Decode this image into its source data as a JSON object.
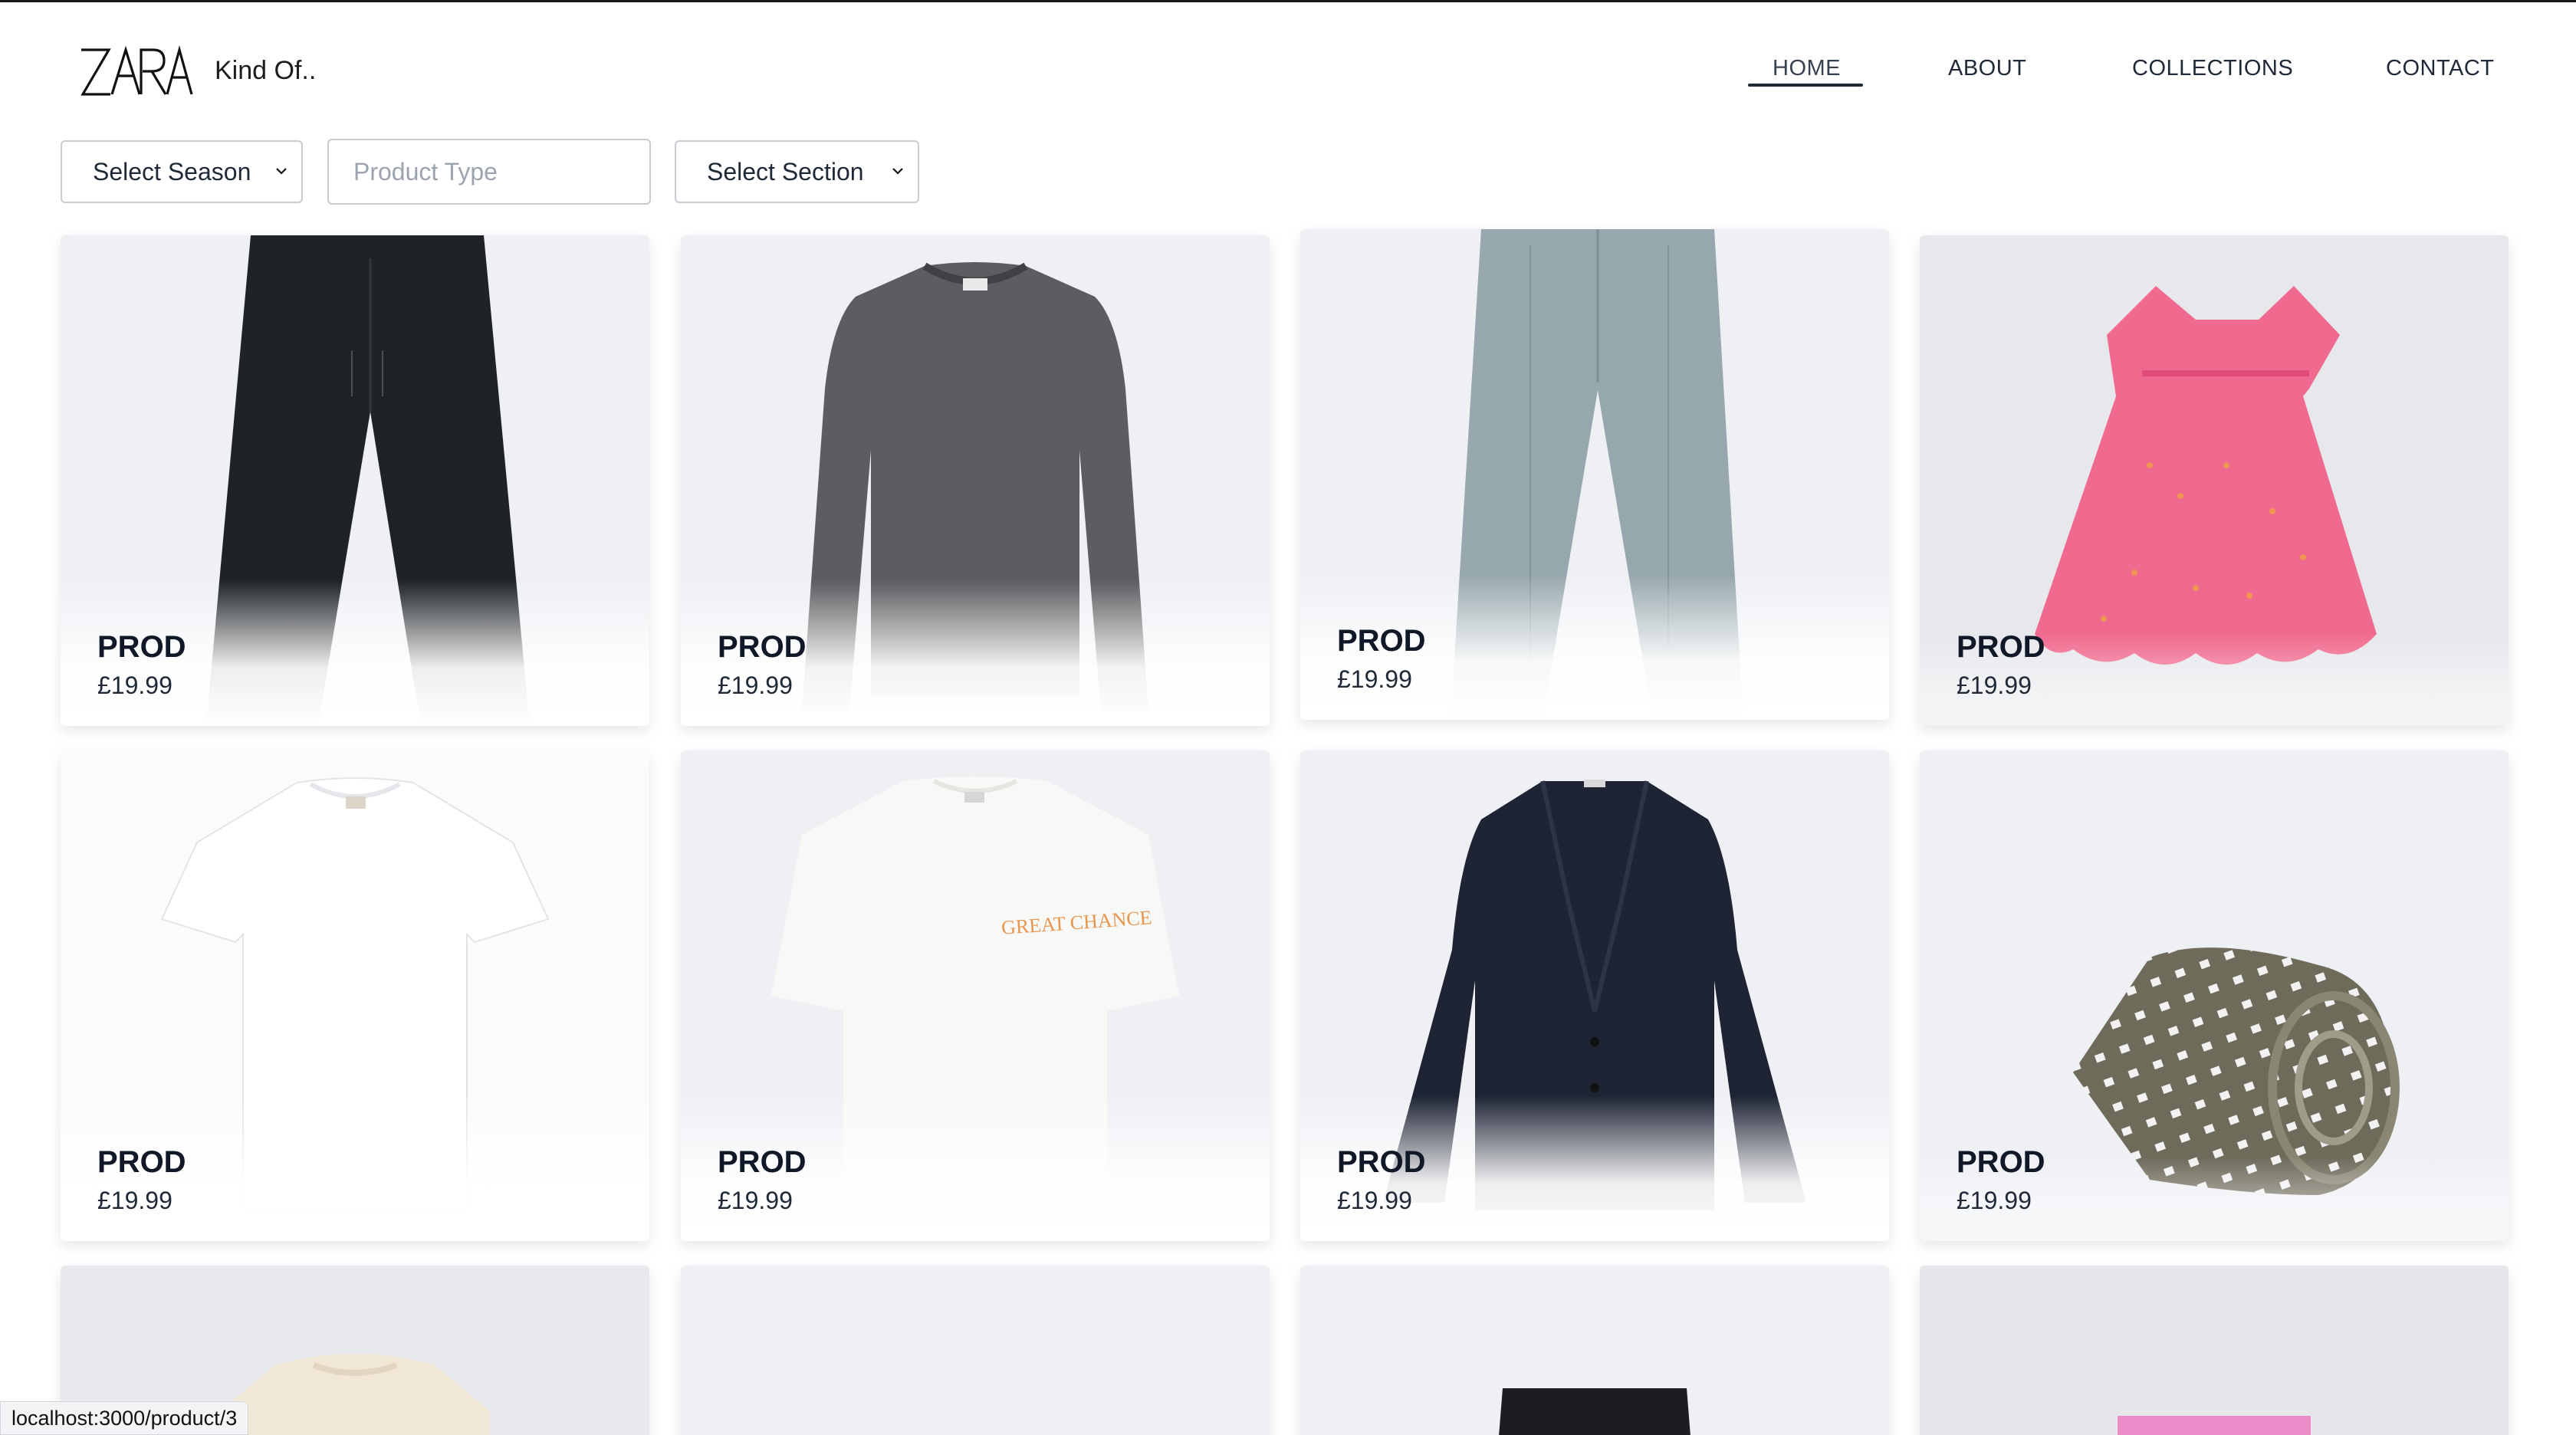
{
  "brand": {
    "logo_text": "ZARA",
    "tagline": "Kind Of.."
  },
  "nav": {
    "items": [
      {
        "label": "HOME",
        "active": true
      },
      {
        "label": "ABOUT",
        "active": false
      },
      {
        "label": "COLLECTIONS",
        "active": false
      },
      {
        "label": "CONTACT",
        "active": false
      }
    ]
  },
  "filters": {
    "season": {
      "selected": "Select Season"
    },
    "product_type": {
      "placeholder": "Product Type",
      "value": ""
    },
    "section": {
      "selected": "Select Section"
    }
  },
  "products": [
    {
      "name": "PROD",
      "price": "£19.99",
      "image": "black-trousers"
    },
    {
      "name": "PROD",
      "price": "£19.99",
      "image": "grey-knit-sweater"
    },
    {
      "name": "PROD",
      "price": "£19.99",
      "image": "light-blue-trousers"
    },
    {
      "name": "PROD",
      "price": "£19.99",
      "image": "pink-embroidered-dress"
    },
    {
      "name": "PROD",
      "price": "£19.99",
      "image": "white-tshirt"
    },
    {
      "name": "PROD",
      "price": "£19.99",
      "image": "white-graphic-tshirt"
    },
    {
      "name": "PROD",
      "price": "£19.99",
      "image": "navy-blazer"
    },
    {
      "name": "PROD",
      "price": "£19.99",
      "image": "olive-polka-dot-tie"
    },
    {
      "image": "cream-knit-sweater"
    },
    {
      "image": "empty"
    },
    {
      "image": "black-shorts"
    },
    {
      "image": "pink-item"
    }
  ],
  "graphic_text": "GREAT CHANCE",
  "status_bar": {
    "url": "localhost:3000/product/3"
  },
  "colors": {
    "card_bg": "#eef0f4",
    "text_dark": "#111827",
    "nav_underline": "#1f2937"
  }
}
